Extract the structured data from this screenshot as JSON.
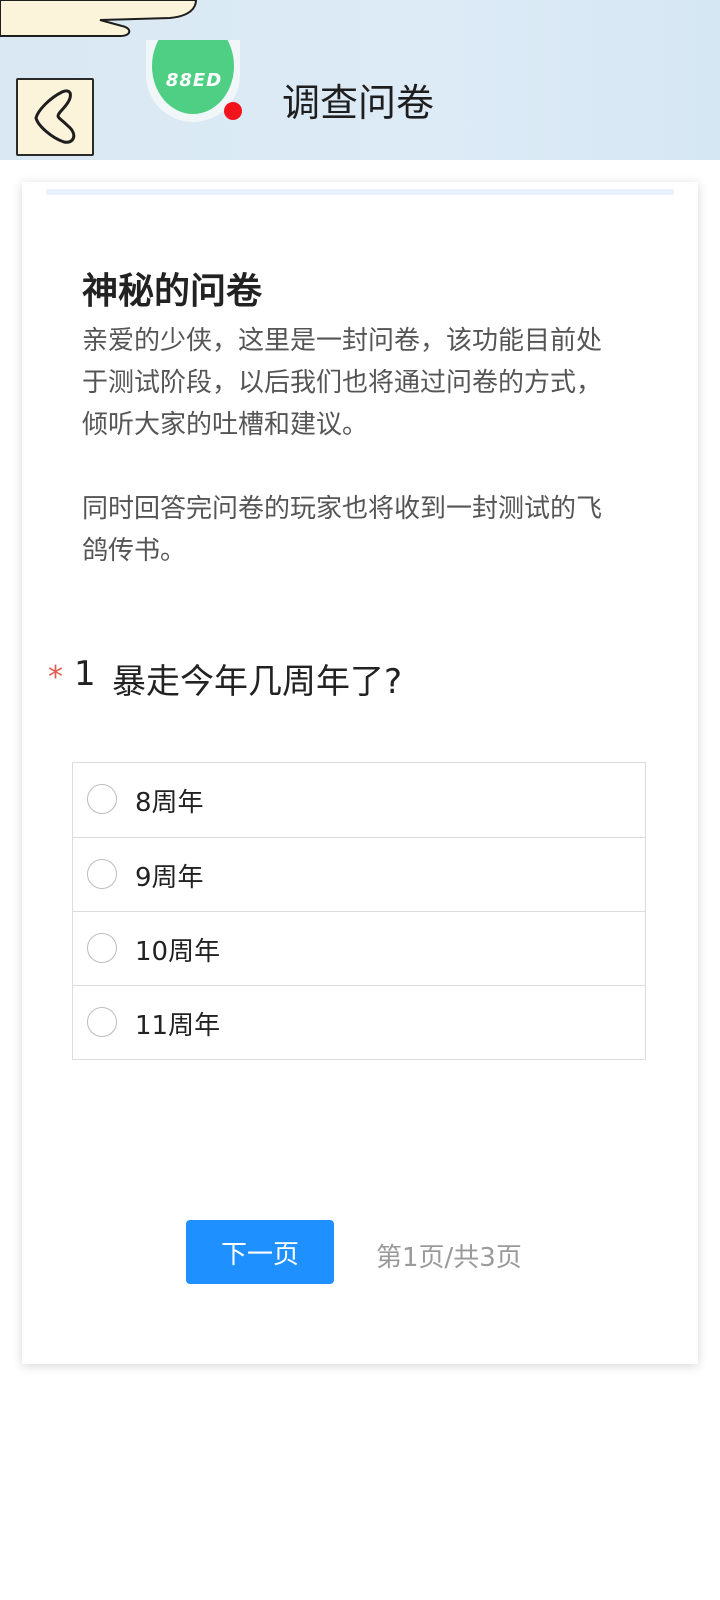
{
  "header": {
    "title": "调查问卷",
    "back_icon": "back-arrow-icon",
    "avatar_text": "88ED",
    "notification_dot_color": "#f2141c"
  },
  "survey": {
    "title": "神秘的问卷",
    "description": [
      "亲爱的少侠，这里是一封问卷，该功能目前处于测试阶段，以后我们也将通过问卷的方式，倾听大家的吐槽和建议。",
      "同时回答完问卷的玩家也将收到一封测试的飞鸽传书。"
    ]
  },
  "question": {
    "required_mark": "*",
    "number": "1",
    "text": "暴走今年几周年了?",
    "options": [
      {
        "label": "8周年",
        "selected": false
      },
      {
        "label": "9周年",
        "selected": false
      },
      {
        "label": "10周年",
        "selected": false
      },
      {
        "label": "11周年",
        "selected": false
      }
    ]
  },
  "pagination": {
    "next_label": "下一页",
    "page_info": "第1页/共3页"
  },
  "colors": {
    "accent": "#1e90ff",
    "required": "#e05b4f",
    "header_bg": "#d9e8f3"
  }
}
